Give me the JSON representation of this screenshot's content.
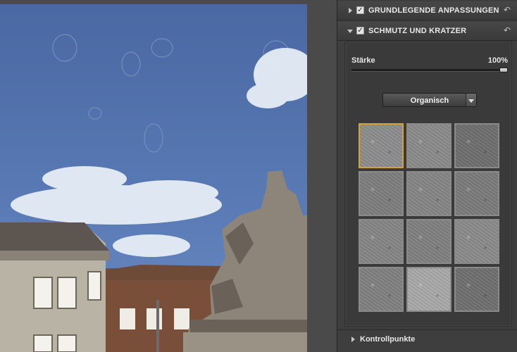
{
  "panel": {
    "section1": {
      "title": "GRUNDLEGENDE ANPASSUNGEN",
      "checked": "✓",
      "reset_icon": "reset-arrow-icon"
    },
    "section2": {
      "title": "SCHMUTZ UND KRATZER",
      "checked": "✓",
      "reset_icon": "reset-arrow-icon"
    },
    "strength": {
      "label": "Stärke",
      "value_text": "100%",
      "value": 1.0
    },
    "preset_dropdown": {
      "selected": "Organisch"
    },
    "textures": {
      "selected_index": 0,
      "items": [
        {
          "name": "texture-1",
          "tone": "#8c8c8c"
        },
        {
          "name": "texture-2",
          "tone": "#8a8a8a"
        },
        {
          "name": "texture-3",
          "tone": "#6e6e6e"
        },
        {
          "name": "texture-4",
          "tone": "#7d7d7d"
        },
        {
          "name": "texture-5",
          "tone": "#858585"
        },
        {
          "name": "texture-6",
          "tone": "#7a7a7a"
        },
        {
          "name": "texture-7",
          "tone": "#858585"
        },
        {
          "name": "texture-8",
          "tone": "#7f7f7f"
        },
        {
          "name": "texture-9",
          "tone": "#8a8a8a"
        },
        {
          "name": "texture-10",
          "tone": "#808080"
        },
        {
          "name": "texture-11",
          "tone": "#a8a8a8"
        },
        {
          "name": "texture-12",
          "tone": "#6f6f6f"
        }
      ]
    },
    "control_points": {
      "title": "Kontrollpunkte"
    }
  },
  "colors": {
    "accent_selected": "#d8a230",
    "sky": "#4f6ea6",
    "panel_bg": "#3e3e3e"
  }
}
